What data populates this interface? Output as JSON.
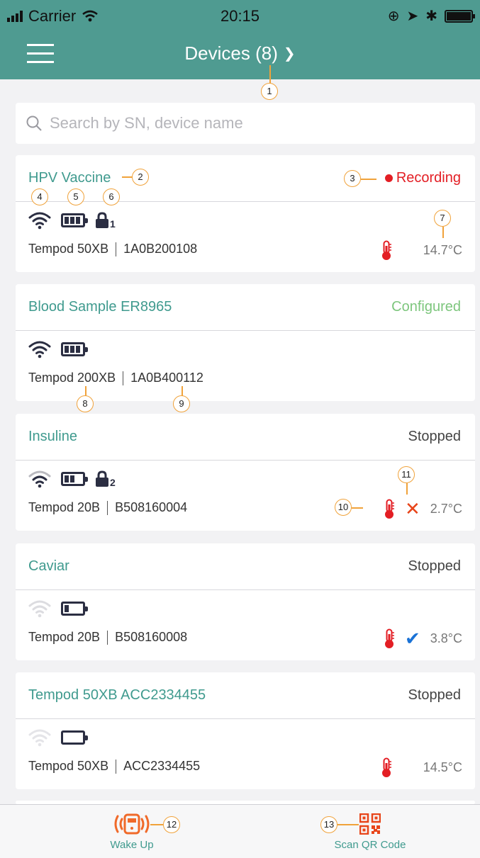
{
  "statusbar": {
    "carrier": "Carrier",
    "time": "20:15"
  },
  "header": {
    "title": "Devices (8)"
  },
  "search": {
    "placeholder": "Search by SN, device name"
  },
  "devices": [
    {
      "name": "HPV Vaccine",
      "status": "Recording",
      "model": "Tempod 50XB",
      "serial": "1A0B200108",
      "temperature": "14.7°C",
      "lock_count": "1",
      "wifi_level": 3,
      "battery_level": 3
    },
    {
      "name": "Blood Sample ER8965",
      "status": "Configured",
      "model": "Tempod 200XB",
      "serial": "1A0B400112",
      "temperature": "",
      "wifi_level": 3,
      "battery_level": 3
    },
    {
      "name": "Insuline",
      "status": "Stopped",
      "model": "Tempod 20B",
      "serial": "B508160004",
      "temperature": "2.7°C",
      "lock_count": "2",
      "alarm": "x",
      "wifi_level": 2,
      "battery_level": 2
    },
    {
      "name": "Caviar",
      "status": "Stopped",
      "model": "Tempod 20B",
      "serial": "B508160008",
      "temperature": "3.8°C",
      "alarm": "check",
      "wifi_level": 0,
      "battery_level": 1
    },
    {
      "name": "Tempod 50XB ACC2334455",
      "status": "Stopped",
      "model": "Tempod 50XB",
      "serial": "ACC2334455",
      "temperature": "14.5°C",
      "wifi_level": 0,
      "battery_level": 0
    }
  ],
  "bottom_bar": {
    "wake_up": "Wake Up",
    "scan_qr": "Scan QR Code"
  },
  "callouts": [
    "1",
    "2",
    "3",
    "4",
    "5",
    "6",
    "7",
    "8",
    "9",
    "10",
    "11",
    "12",
    "13"
  ],
  "colors": {
    "header": "#4f9b91",
    "accent": "#3f9a8e",
    "recording": "#e31e24",
    "configured": "#7dc67d",
    "wake_icon": "#f06a2a",
    "qr_icon": "#e8451a",
    "check": "#1a72d6"
  },
  "icons": [
    "menu-icon",
    "chevron-down-icon",
    "search-icon",
    "wifi-icon",
    "battery-icon",
    "lock-icon",
    "thermometer-icon",
    "x-mark-icon",
    "check-mark-icon",
    "wake-up-icon",
    "qr-code-icon"
  ]
}
